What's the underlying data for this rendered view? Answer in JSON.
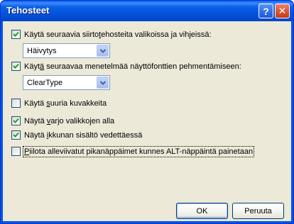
{
  "window": {
    "title": "Tehosteet",
    "help_glyph": "?",
    "close_glyph": "✕"
  },
  "options": {
    "transitions": {
      "label_pre": "Käytä seuraavia siirto",
      "label_accel": "t",
      "label_post": "ehosteita valikoissa ja vihjeissä:",
      "checked": true
    },
    "transition_effect": {
      "value": "Häivytys"
    },
    "smoothing": {
      "label_pre": "Käyt",
      "label_accel": "ä",
      "label_post": " seuraavaa menetelmää näyttöfonttien pehmentämiseen:",
      "checked": true
    },
    "smoothing_method": {
      "value": "ClearType"
    },
    "large_icons": {
      "label_pre": "Käytä ",
      "label_accel": "s",
      "label_post": "uuria kuvakkeita",
      "checked": false
    },
    "menu_shadow": {
      "label_pre": "Näytä ",
      "label_accel": "v",
      "label_post": "arjo valikkojen alla",
      "checked": true
    },
    "drag_contents": {
      "label_pre": "Näytä ",
      "label_accel": "i",
      "label_post": "kkunan sisältö vedettäessä",
      "checked": true
    },
    "hide_underlines": {
      "label_pre": "",
      "label_accel": "P",
      "label_post": "iilota alleviivatut pikanäppäimet kunnes ALT-näppäintä painetaan",
      "checked": false
    }
  },
  "buttons": {
    "ok": "OK",
    "cancel": "Peruuta"
  },
  "colors": {
    "titlebar": "#0054e3",
    "dialog_bg": "#ece9d8",
    "check_mark": "#21a121"
  }
}
